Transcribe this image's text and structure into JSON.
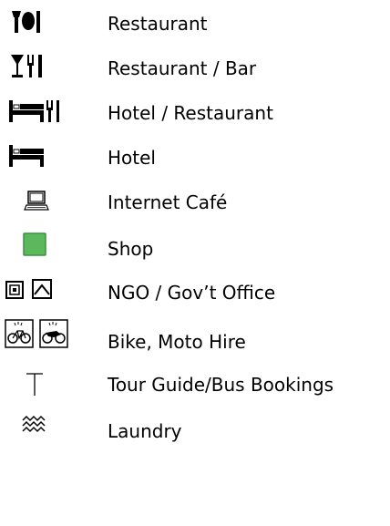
{
  "legend": {
    "items": [
      {
        "label": "Restaurant",
        "icon": "restaurant-icon"
      },
      {
        "label": "Restaurant / Bar",
        "icon": "restaurant-bar-icon"
      },
      {
        "label": "Hotel / Restaurant",
        "icon": "hotel-restaurant-icon"
      },
      {
        "label": "Hotel",
        "icon": "hotel-icon"
      },
      {
        "label": "Internet Café",
        "icon": "internet-cafe-icon"
      },
      {
        "label": "Shop",
        "icon": "shop-icon"
      },
      {
        "label": "NGO / Gov’t Office",
        "icon": "ngo-gov-office-icon"
      },
      {
        "label": "Bike, Moto Hire",
        "icon": "bike-moto-hire-icon"
      },
      {
        "label": "Tour Guide/Bus Bookings",
        "icon": "tour-guide-icon"
      },
      {
        "label": "Laundry",
        "icon": "laundry-icon"
      }
    ],
    "colors": {
      "ink": "#000000",
      "shop_fill": "#5cb85c",
      "shop_border": "#3f8f3f",
      "background": "#ffffff"
    }
  }
}
